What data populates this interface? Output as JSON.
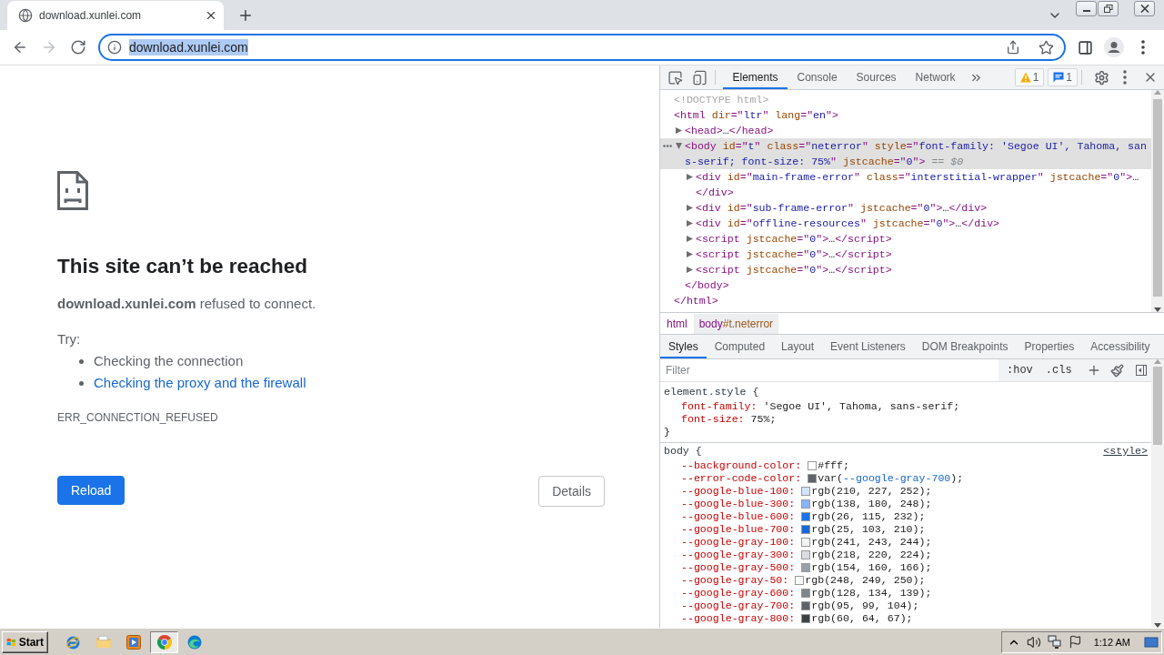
{
  "browser": {
    "tabs": [
      {
        "title": "download.xunlei.com",
        "selected": true
      }
    ],
    "nav_buttons": [
      {
        "kind": "back",
        "disabled": false
      },
      {
        "kind": "forward",
        "disabled": true
      },
      {
        "kind": "reload",
        "disabled": false
      }
    ],
    "address_bar": {
      "url": "download.xunlei.com",
      "text_selected": true
    }
  },
  "error_page": {
    "heading": "This site can’t be reached",
    "message": "**download.xunlei.com** refused to connect.",
    "try_label": "Try:",
    "suggestions": [
      {
        "text": "Checking the connection",
        "kind": "text"
      },
      {
        "text": "Checking the proxy and the firewall",
        "kind": "link"
      }
    ],
    "error_code": "ERR_CONNECTION_REFUSED",
    "buttons": [
      {
        "label": "Reload",
        "kind": "primary"
      },
      {
        "label": "Details",
        "kind": "secondary"
      }
    ]
  },
  "devtools": {
    "tabs": [
      {
        "label": "Elements",
        "selected": true
      },
      {
        "label": "Console",
        "selected": false
      },
      {
        "label": "Sources",
        "selected": false
      },
      {
        "label": "Network",
        "selected": false
      }
    ],
    "issue_badges": [
      {
        "kind": "warning",
        "count": "1"
      },
      {
        "kind": "message",
        "count": "1"
      }
    ],
    "dom_tree": [
      {
        "selected": false,
        "open": [
          {
            "kind": "doctype",
            "text": "<!DOCTYPE html>"
          }
        ]
      },
      {
        "selected": false,
        "open": [
          {
            "kind": "tag",
            "text": "<html "
          },
          {
            "kind": "attr",
            "text": "dir"
          },
          {
            "kind": "tag",
            "text": "=\""
          },
          {
            "kind": "value",
            "text": "ltr"
          },
          {
            "kind": "tag",
            "text": "\" "
          },
          {
            "kind": "attr",
            "text": "lang"
          },
          {
            "kind": "tag",
            "text": "=\""
          },
          {
            "kind": "value",
            "text": "en"
          },
          {
            "kind": "tag",
            "text": "\">"
          }
        ],
        "close": [
          {
            "kind": "tag",
            "text": "</html>"
          }
        ],
        "children": [
          {
            "selected": false,
            "expanded": false,
            "open": [
              {
                "kind": "tag",
                "text": "<head>"
              },
              {
                "kind": "text",
                "text": "…"
              }
            ],
            "close": [
              {
                "kind": "tag",
                "text": "</head>"
              }
            ]
          },
          {
            "selected": true,
            "expanded": true,
            "open": [
              {
                "kind": "tag",
                "text": "<body "
              },
              {
                "kind": "attr",
                "text": "id"
              },
              {
                "kind": "tag",
                "text": "=\""
              },
              {
                "kind": "value",
                "text": "t"
              },
              {
                "kind": "tag",
                "text": "\" "
              },
              {
                "kind": "attr",
                "text": "class"
              },
              {
                "kind": "tag",
                "text": "=\""
              },
              {
                "kind": "value",
                "text": "neterror"
              },
              {
                "kind": "tag",
                "text": "\" "
              },
              {
                "kind": "attr",
                "text": "style"
              },
              {
                "kind": "tag",
                "text": "=\""
              },
              {
                "kind": "value",
                "text": "font-family: 'Segoe UI', Tahoma, sans-serif; font-size: 75%"
              },
              {
                "kind": "tag",
                "text": "\" "
              },
              {
                "kind": "attr",
                "text": "jstcache"
              },
              {
                "kind": "tag",
                "text": "=\""
              },
              {
                "kind": "value",
                "text": "0"
              },
              {
                "kind": "tag",
                "text": "\">"
              },
              {
                "kind": "ref",
                "text": " == $0"
              }
            ],
            "close": [
              {
                "kind": "tag",
                "text": "</body>"
              }
            ],
            "children": [
              {
                "selected": false,
                "expanded": false,
                "open": [
                  {
                    "kind": "tag",
                    "text": "<div "
                  },
                  {
                    "kind": "attr",
                    "text": "id"
                  },
                  {
                    "kind": "tag",
                    "text": "=\""
                  },
                  {
                    "kind": "value",
                    "text": "main-frame-error"
                  },
                  {
                    "kind": "tag",
                    "text": "\" "
                  },
                  {
                    "kind": "attr",
                    "text": "class"
                  },
                  {
                    "kind": "tag",
                    "text": "=\""
                  },
                  {
                    "kind": "value",
                    "text": "interstitial-wrapper"
                  },
                  {
                    "kind": "tag",
                    "text": "\" "
                  },
                  {
                    "kind": "attr",
                    "text": "jstcache"
                  },
                  {
                    "kind": "tag",
                    "text": "=\""
                  },
                  {
                    "kind": "value",
                    "text": "0"
                  },
                  {
                    "kind": "tag",
                    "text": "\">"
                  },
                  {
                    "kind": "text",
                    "text": "…"
                  }
                ],
                "close": [
                  {
                    "kind": "tag",
                    "text": "</div>"
                  }
                ]
              },
              {
                "selected": false,
                "expanded": false,
                "open": [
                  {
                    "kind": "tag",
                    "text": "<div "
                  },
                  {
                    "kind": "attr",
                    "text": "id"
                  },
                  {
                    "kind": "tag",
                    "text": "=\""
                  },
                  {
                    "kind": "value",
                    "text": "sub-frame-error"
                  },
                  {
                    "kind": "tag",
                    "text": "\" "
                  },
                  {
                    "kind": "attr",
                    "text": "jstcache"
                  },
                  {
                    "kind": "tag",
                    "text": "=\""
                  },
                  {
                    "kind": "value",
                    "text": "0"
                  },
                  {
                    "kind": "tag",
                    "text": "\">"
                  },
                  {
                    "kind": "text",
                    "text": "…"
                  }
                ],
                "close": [
                  {
                    "kind": "tag",
                    "text": "</div>"
                  }
                ]
              },
              {
                "selected": false,
                "expanded": false,
                "open": [
                  {
                    "kind": "tag",
                    "text": "<div "
                  },
                  {
                    "kind": "attr",
                    "text": "id"
                  },
                  {
                    "kind": "tag",
                    "text": "=\""
                  },
                  {
                    "kind": "value",
                    "text": "offline-resources"
                  },
                  {
                    "kind": "tag",
                    "text": "\" "
                  },
                  {
                    "kind": "attr",
                    "text": "jstcache"
                  },
                  {
                    "kind": "tag",
                    "text": "=\""
                  },
                  {
                    "kind": "value",
                    "text": "0"
                  },
                  {
                    "kind": "tag",
                    "text": "\">"
                  },
                  {
                    "kind": "text",
                    "text": "…"
                  }
                ],
                "close": [
                  {
                    "kind": "tag",
                    "text": "</div>"
                  }
                ]
              },
              {
                "selected": false,
                "expanded": false,
                "open": [
                  {
                    "kind": "tag",
                    "text": "<script "
                  },
                  {
                    "kind": "attr",
                    "text": "jstcache"
                  },
                  {
                    "kind": "tag",
                    "text": "=\""
                  },
                  {
                    "kind": "value",
                    "text": "0"
                  },
                  {
                    "kind": "tag",
                    "text": "\">"
                  },
                  {
                    "kind": "text",
                    "text": "…"
                  }
                ],
                "close": [
                  {
                    "kind": "tag",
                    "text": "</script>"
                  }
                ]
              },
              {
                "selected": false,
                "expanded": false,
                "open": [
                  {
                    "kind": "tag",
                    "text": "<script "
                  },
                  {
                    "kind": "attr",
                    "text": "jstcache"
                  },
                  {
                    "kind": "tag",
                    "text": "=\""
                  },
                  {
                    "kind": "value",
                    "text": "0"
                  },
                  {
                    "kind": "tag",
                    "text": "\">"
                  },
                  {
                    "kind": "text",
                    "text": "…"
                  }
                ],
                "close": [
                  {
                    "kind": "tag",
                    "text": "</script>"
                  }
                ]
              },
              {
                "selected": false,
                "expanded": false,
                "open": [
                  {
                    "kind": "tag",
                    "text": "<script "
                  },
                  {
                    "kind": "attr",
                    "text": "jstcache"
                  },
                  {
                    "kind": "tag",
                    "text": "=\""
                  },
                  {
                    "kind": "value",
                    "text": "0"
                  },
                  {
                    "kind": "tag",
                    "text": "\">"
                  },
                  {
                    "kind": "text",
                    "text": "…"
                  }
                ],
                "close": [
                  {
                    "kind": "tag",
                    "text": "</script>"
                  }
                ]
              }
            ]
          }
        ]
      }
    ],
    "breadcrumbs": [
      {
        "segments": [
          {
            "kind": "tag",
            "text": "html"
          }
        ],
        "selected": false
      },
      {
        "segments": [
          {
            "kind": "tag",
            "text": "body"
          },
          {
            "kind": "attr",
            "text": "#t.neterror"
          }
        ],
        "selected": true
      }
    ],
    "sidebar_tabs": [
      {
        "label": "Styles",
        "selected": true
      },
      {
        "label": "Computed",
        "selected": false
      },
      {
        "label": "Layout",
        "selected": false
      },
      {
        "label": "Event Listeners",
        "selected": false
      },
      {
        "label": "DOM Breakpoints",
        "selected": false
      },
      {
        "label": "Properties",
        "selected": false
      },
      {
        "label": "Accessibility",
        "selected": false
      }
    ],
    "filter": {
      "placeholder": "Filter"
    },
    "style_toggles": [
      ":hov",
      ".cls"
    ],
    "style_rules": [
      {
        "selector": "element.style {",
        "declarations": [
          {
            "property": "font-family:",
            "value": [
              {
                "kind": "text",
                "text": "'Segoe UI', Tahoma, sans-serif;"
              }
            ]
          },
          {
            "property": "font-size:",
            "value": [
              {
                "kind": "text",
                "text": "75%;"
              }
            ]
          }
        ],
        "closing": "}"
      },
      {
        "selector": "body {",
        "source": "<style>",
        "declarations": [
          {
            "property": "--background-color:",
            "color": "#ffffff",
            "value": [
              {
                "kind": "text",
                "text": "#fff;"
              }
            ]
          },
          {
            "property": "--error-code-color:",
            "color": "#5f6368",
            "value": [
              {
                "kind": "text",
                "text": "var("
              },
              {
                "kind": "variable",
                "text": "--google-gray-700"
              },
              {
                "kind": "text",
                "text": ");"
              }
            ]
          },
          {
            "property": "--google-blue-100:",
            "color": "#d2e3fc",
            "value": [
              {
                "kind": "text",
                "text": "rgb(210, 227, 252);"
              }
            ]
          },
          {
            "property": "--google-blue-300:",
            "color": "#8ab4f8",
            "value": [
              {
                "kind": "text",
                "text": "rgb(138, 180, 248);"
              }
            ]
          },
          {
            "property": "--google-blue-600:",
            "color": "#1a73e8",
            "value": [
              {
                "kind": "text",
                "text": "rgb(26, 115, 232);"
              }
            ]
          },
          {
            "property": "--google-blue-700:",
            "color": "#1967d2",
            "value": [
              {
                "kind": "text",
                "text": "rgb(25, 103, 210);"
              }
            ]
          },
          {
            "property": "--google-gray-100:",
            "color": "#f1f3f4",
            "value": [
              {
                "kind": "text",
                "text": "rgb(241, 243, 244);"
              }
            ]
          },
          {
            "property": "--google-gray-300:",
            "color": "#dadce0",
            "value": [
              {
                "kind": "text",
                "text": "rgb(218, 220, 224);"
              }
            ]
          },
          {
            "property": "--google-gray-500:",
            "color": "#9aa0a6",
            "value": [
              {
                "kind": "text",
                "text": "rgb(154, 160, 166);"
              }
            ]
          },
          {
            "property": "--google-gray-50:",
            "color": "#f8f9fa",
            "value": [
              {
                "kind": "text",
                "text": "rgb(248, 249, 250);"
              }
            ]
          },
          {
            "property": "--google-gray-600:",
            "color": "#80868b",
            "value": [
              {
                "kind": "text",
                "text": "rgb(128, 134, 139);"
              }
            ]
          },
          {
            "property": "--google-gray-700:",
            "color": "#5f6368",
            "value": [
              {
                "kind": "text",
                "text": "rgb(95, 99, 104);"
              }
            ]
          },
          {
            "property": "--google-gray-800:",
            "color": "#3c4043",
            "value": [
              {
                "kind": "text",
                "text": "rgb(60, 64, 67);"
              }
            ]
          }
        ]
      }
    ]
  },
  "taskbar": {
    "start_label": "Start",
    "apps": [
      {
        "kind": "ie",
        "active": false
      },
      {
        "kind": "folder",
        "active": false
      },
      {
        "kind": "media",
        "active": false
      },
      {
        "kind": "chrome",
        "active": true
      },
      {
        "kind": "edge",
        "active": false
      }
    ],
    "clock": "1:12 AM"
  }
}
